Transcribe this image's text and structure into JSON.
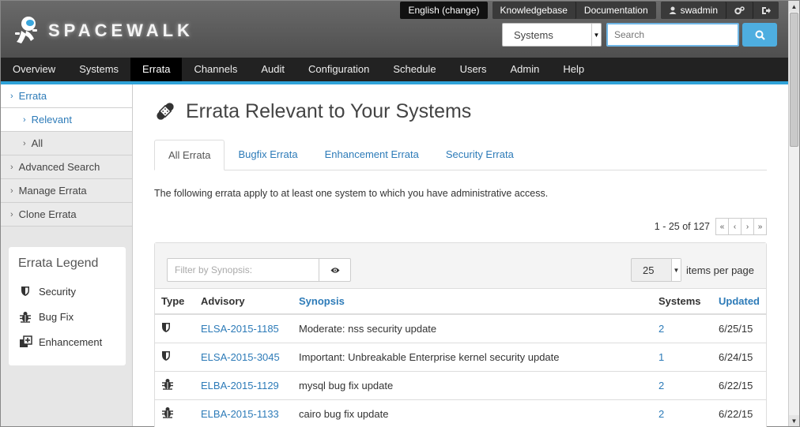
{
  "brand": {
    "name": "SPACEWALK"
  },
  "topbar": {
    "language": "English (change)",
    "knowledgebase": "Knowledgebase",
    "documentation": "Documentation",
    "user": "swadmin"
  },
  "search": {
    "scope": "Systems",
    "placeholder": "Search"
  },
  "nav": {
    "items": [
      {
        "label": "Overview"
      },
      {
        "label": "Systems"
      },
      {
        "label": "Errata"
      },
      {
        "label": "Channels"
      },
      {
        "label": "Audit"
      },
      {
        "label": "Configuration"
      },
      {
        "label": "Schedule"
      },
      {
        "label": "Users"
      },
      {
        "label": "Admin"
      },
      {
        "label": "Help"
      }
    ],
    "active": "Errata"
  },
  "sidebar": {
    "items": [
      {
        "label": "Errata"
      },
      {
        "label": "Relevant"
      },
      {
        "label": "All"
      },
      {
        "label": "Advanced Search"
      },
      {
        "label": "Manage Errata"
      },
      {
        "label": "Clone Errata"
      }
    ]
  },
  "legend": {
    "title": "Errata Legend",
    "items": [
      {
        "label": "Security",
        "icon": "shield-icon"
      },
      {
        "label": "Bug Fix",
        "icon": "bug-icon"
      },
      {
        "label": "Enhancement",
        "icon": "enhancement-icon"
      }
    ]
  },
  "main": {
    "title": "Errata Relevant to Your Systems",
    "tabs": [
      {
        "label": "All Errata"
      },
      {
        "label": "Bugfix Errata"
      },
      {
        "label": "Enhancement Errata"
      },
      {
        "label": "Security Errata"
      }
    ],
    "intro": "The following errata apply to at least one system to which you have administrative access.",
    "pager": {
      "text": "1 - 25 of 127"
    },
    "filter": {
      "placeholder": "Filter by Synopsis:"
    },
    "per_page": {
      "value": "25",
      "label": "items per page"
    },
    "table": {
      "headers": {
        "type": "Type",
        "advisory": "Advisory",
        "synopsis": "Synopsis",
        "systems": "Systems",
        "updated": "Updated"
      },
      "rows": [
        {
          "type": "security",
          "advisory": "ELSA-2015-1185",
          "synopsis": "Moderate: nss security update",
          "systems": "2",
          "updated": "6/25/15"
        },
        {
          "type": "security",
          "advisory": "ELSA-2015-3045",
          "synopsis": "Important: Unbreakable Enterprise kernel security update",
          "systems": "1",
          "updated": "6/24/15"
        },
        {
          "type": "bugfix",
          "advisory": "ELBA-2015-1129",
          "synopsis": "mysql bug fix update",
          "systems": "2",
          "updated": "6/22/15"
        },
        {
          "type": "bugfix",
          "advisory": "ELBA-2015-1133",
          "synopsis": "cairo bug fix update",
          "systems": "2",
          "updated": "6/22/15"
        }
      ]
    }
  },
  "colors": {
    "accent": "#2fa2d8",
    "link": "#2d7bb8",
    "nav_bg": "#222222"
  }
}
